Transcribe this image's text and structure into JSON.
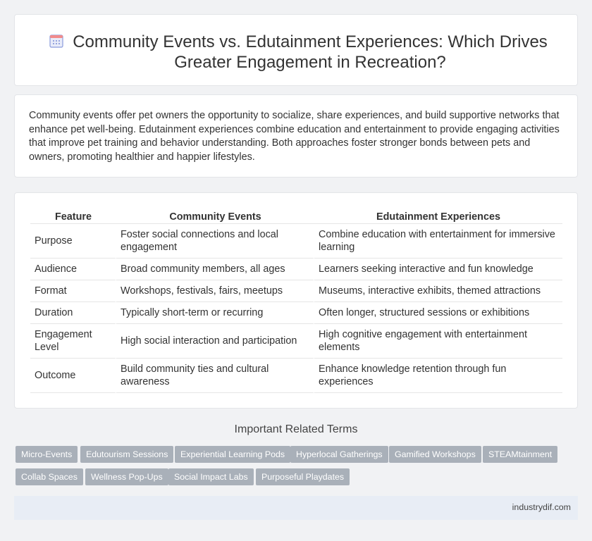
{
  "header": {
    "icon": "calendar-icon",
    "title": "Community Events vs. Edutainment Experiences: Which Drives Greater Engagement in Recreation?"
  },
  "intro": "Community events offer pet owners the opportunity to socialize, share experiences, and build supportive networks that enhance pet well-being. Edutainment experiences combine education and entertainment to provide engaging activities that improve pet training and behavior understanding. Both approaches foster stronger bonds between pets and owners, promoting healthier and happier lifestyles.",
  "table": {
    "headers": [
      "Feature",
      "Community Events",
      "Edutainment Experiences"
    ],
    "rows": [
      [
        "Purpose",
        "Foster social connections and local engagement",
        "Combine education with entertainment for immersive learning"
      ],
      [
        "Audience",
        "Broad community members, all ages",
        "Learners seeking interactive and fun knowledge"
      ],
      [
        "Format",
        "Workshops, festivals, fairs, meetups",
        "Museums, interactive exhibits, themed attractions"
      ],
      [
        "Duration",
        "Typically short-term or recurring",
        "Often longer, structured sessions or exhibitions"
      ],
      [
        "Engagement Level",
        "High social interaction and participation",
        "High cognitive engagement with entertainment elements"
      ],
      [
        "Outcome",
        "Build community ties and cultural awareness",
        "Enhance knowledge retention through fun experiences"
      ]
    ]
  },
  "related": {
    "title": "Important Related Terms",
    "tags": [
      "Micro-Events",
      "Edutourism Sessions",
      "Experiential Learning Pods",
      "Hyperlocal Gatherings",
      "Gamified Workshops",
      "STEAMtainment",
      "Collab Spaces",
      "Wellness Pop-Ups",
      "Social Impact Labs",
      "Purposeful Playdates"
    ]
  },
  "footer": {
    "site": "industrydif.com"
  },
  "colors": {
    "tag_bg": "#a9b0b9",
    "footer_bg": "#e8edf5",
    "icon_accent": "#7b8fd6"
  }
}
